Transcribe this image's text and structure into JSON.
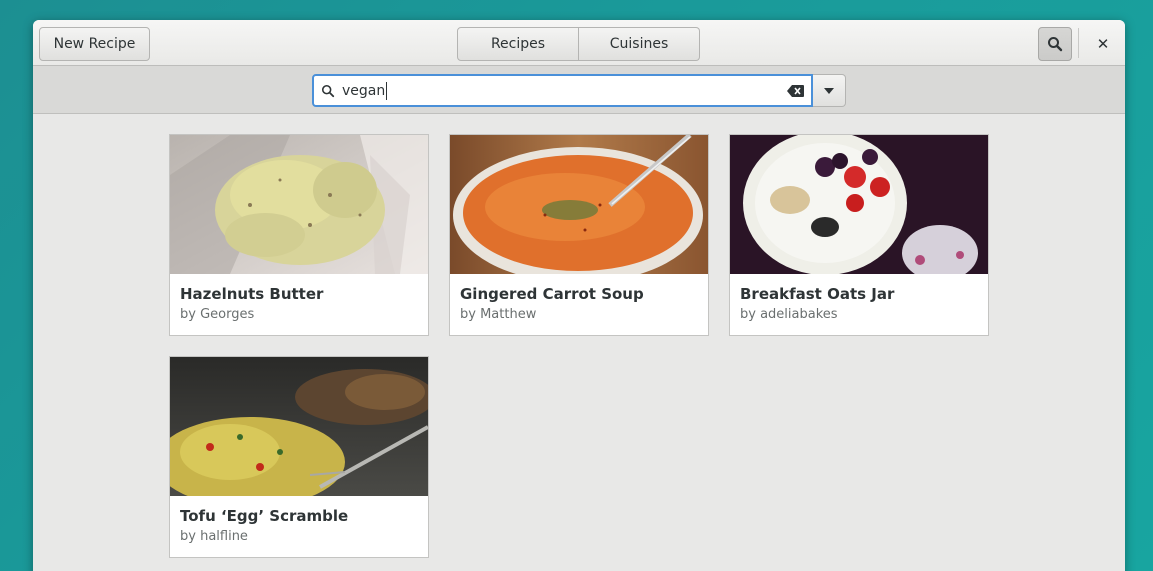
{
  "header": {
    "new_recipe_label": "New Recipe",
    "tabs": [
      {
        "label": "Recipes"
      },
      {
        "label": "Cuisines"
      }
    ],
    "close_glyph": "✕"
  },
  "search": {
    "value": "vegan"
  },
  "recipes": [
    {
      "title": "Hazelnuts Butter",
      "author": "by Georges"
    },
    {
      "title": "Gingered Carrot Soup",
      "author": "by Matthew"
    },
    {
      "title": "Breakfast Oats Jar",
      "author": "by adeliabakes"
    },
    {
      "title": "Tofu ‘Egg’ Scramble",
      "author": "by halfline"
    }
  ],
  "colors": {
    "accent": "#4a90d9",
    "desktop": "#1a9a9a"
  }
}
